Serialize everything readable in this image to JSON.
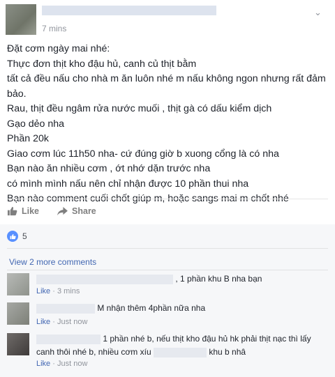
{
  "post": {
    "time": "7 mins",
    "body_lines": [
      "Đặt cơm ngày mai nhé:",
      "Thực đơn thịt kho đậu hủ, canh củ thịt bằm",
      "tất cả đều nấu cho nhà m ăn luôn nhé m nấu không ngon nhưng rất đảm",
      "bảo.",
      "Rau, thịt đều ngâm rửa nước muối , thịt gà có dấu kiểm dịch",
      "Gạo dẻo nha",
      "Phần 20k",
      "Giao cơm lúc 11h50 nha- cứ đúng giờ b xuong cổng là có nha",
      "Bạn nào ăn nhiều cơm , ớt nhớ dặn trước nha",
      "có mình mình nấu nên chỉ nhận được 10 phần thui nha",
      "Bạn nào comment cuối chốt giúp m, hoặc sangs mai m chốt nhé"
    ]
  },
  "actions": {
    "like_label": "Like",
    "share_label": "Share"
  },
  "reactions": {
    "count": "5"
  },
  "comments_section": {
    "view_more": "View 2 more comments",
    "comments": [
      {
        "text": ", 1 phần khu B nha bạn",
        "like": "Like",
        "time": "3 mins"
      },
      {
        "text": "M nhận thêm 4phần nữa nha",
        "like": "Like",
        "time": "Just now"
      },
      {
        "text_line1": "1 phần nhé b, nếu thịt kho đậu hủ hk phải thịt nạc thì lấy",
        "text_line2_a": "canh thôi nhé b, nhiều cơm xíu",
        "text_line2_b": "khu b nhâ",
        "like": "Like",
        "time": "Just now"
      }
    ]
  },
  "colors": {
    "link": "#4267b2",
    "meta": "#90949c",
    "like_badge": "#5890ff"
  },
  "icons": [
    "chevron-down-icon",
    "thumbs-up-icon",
    "share-arrow-icon",
    "like-reaction-icon"
  ]
}
